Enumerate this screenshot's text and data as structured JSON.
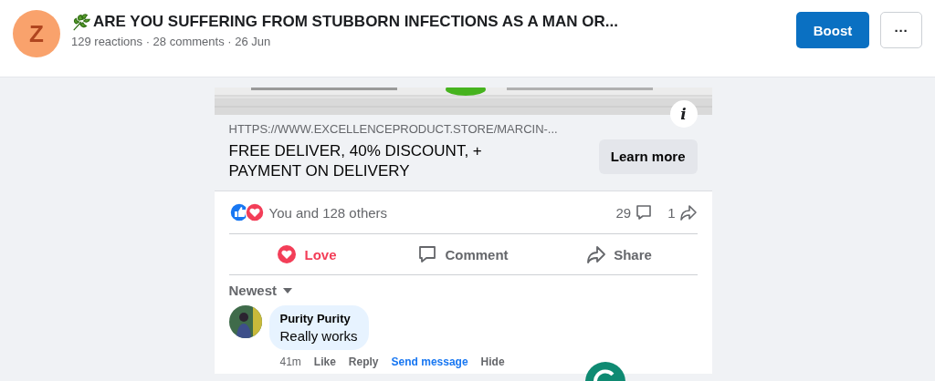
{
  "header": {
    "avatar_letter": "Z",
    "title": "ARE YOU SUFFERING FROM STUBBORN INFECTIONS AS A MAN OR...",
    "meta": "129 reactions · 28 comments · 26 Jun",
    "boost_label": "Boost",
    "more_label": "···"
  },
  "ad": {
    "url": "HTTPS://WWW.EXCELLENCEPRODUCT.STORE/MARCIN-...",
    "headline": "FREE DELIVER, 40% DISCOUNT, + PAYMENT ON DELIVERY",
    "cta": "Learn more",
    "info_label": "i"
  },
  "stats": {
    "reactions_text": "You and 128 others",
    "comments": "29",
    "shares": "1"
  },
  "actions": [
    {
      "kind": "love",
      "label": "Love",
      "selected": true
    },
    {
      "kind": "comment",
      "label": "Comment",
      "selected": false
    },
    {
      "kind": "share",
      "label": "Share",
      "selected": false
    }
  ],
  "sort": {
    "label": "Newest"
  },
  "comments": [
    {
      "author": "Purity Purity",
      "text": "Really works",
      "time": "41m",
      "links": [
        {
          "label": "Like",
          "kind": "plain"
        },
        {
          "label": "Reply",
          "kind": "plain"
        },
        {
          "label": "Send message",
          "kind": "accent"
        },
        {
          "label": "Hide",
          "kind": "plain"
        }
      ]
    }
  ]
}
